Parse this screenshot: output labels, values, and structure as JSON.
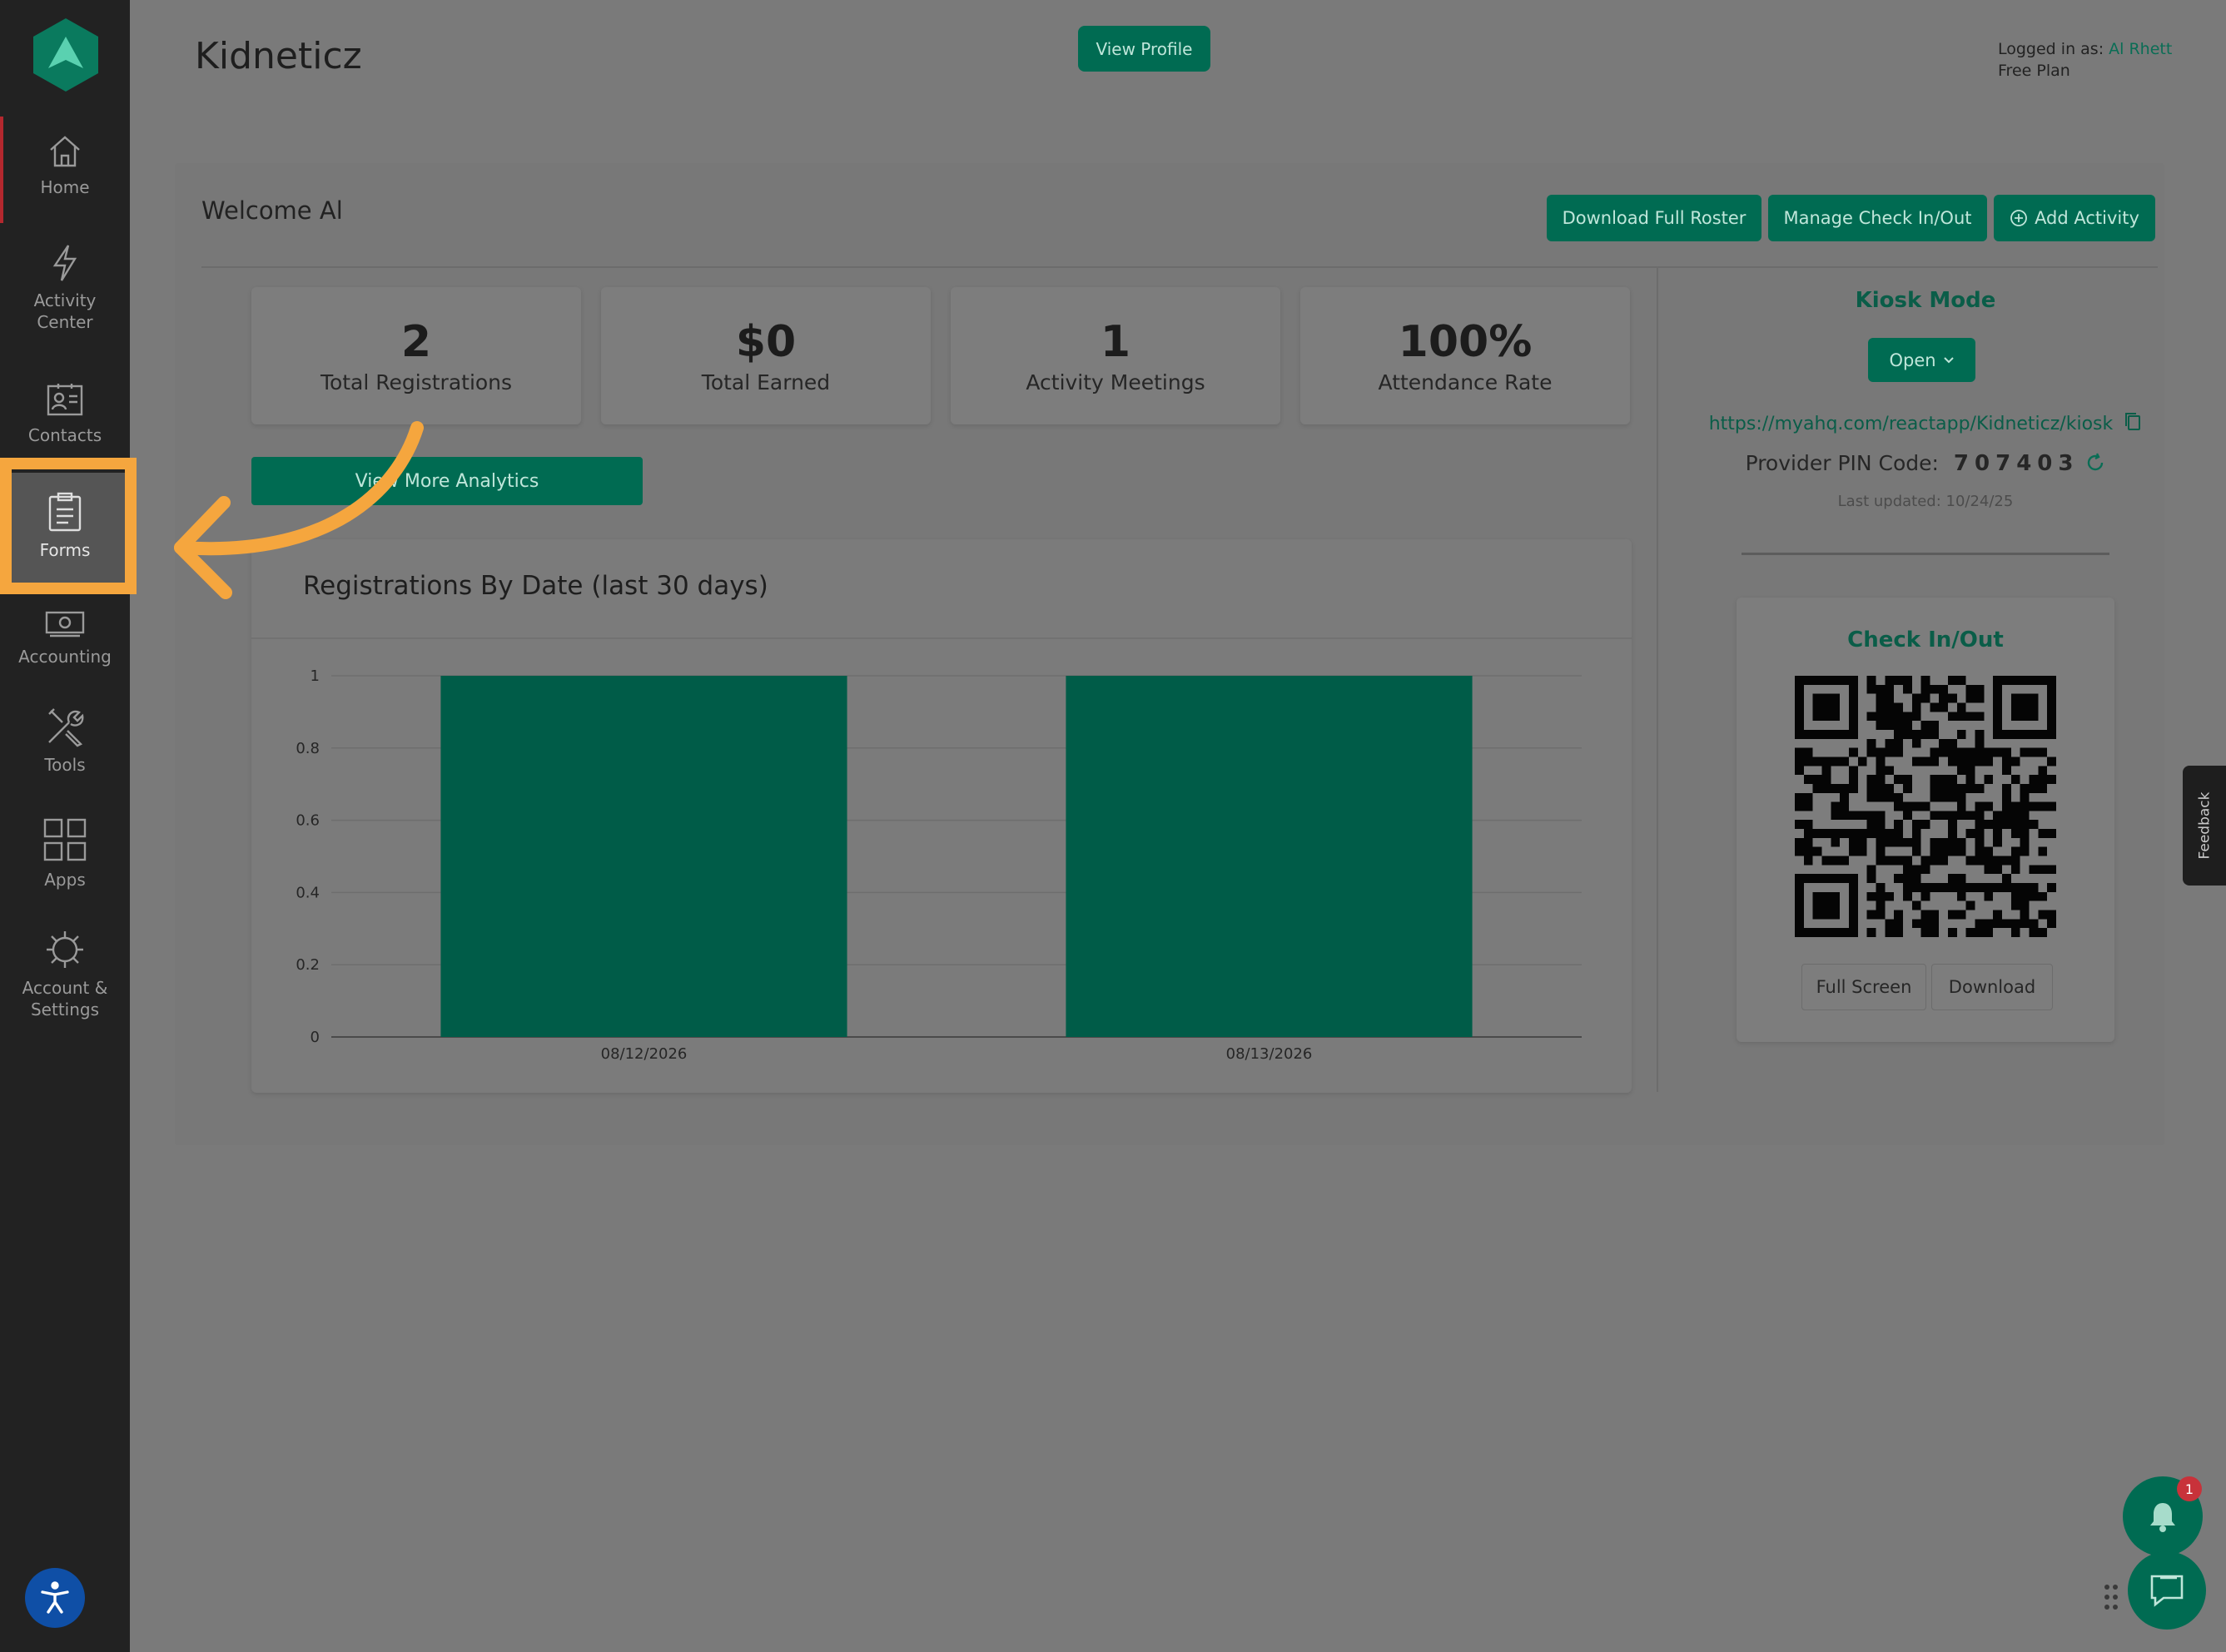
{
  "sidebar": {
    "items": [
      {
        "label": "Home",
        "icon": "home-icon"
      },
      {
        "label": "Activity\nCenter",
        "icon": "lightning-icon"
      },
      {
        "label": "Contacts",
        "icon": "contacts-icon"
      },
      {
        "label": "Forms",
        "icon": "clipboard-icon"
      },
      {
        "label": "Accounting",
        "icon": "money-icon"
      },
      {
        "label": "Tools",
        "icon": "tools-icon"
      },
      {
        "label": "Apps",
        "icon": "grid-icon"
      },
      {
        "label": "Account &\nSettings",
        "icon": "gear-icon"
      }
    ],
    "active": "Forms"
  },
  "header": {
    "title": "Kidneticz",
    "view_profile": "View Profile",
    "logged_in_label": "Logged in as:",
    "user_name": "Al Rhett",
    "plan": "Free Plan"
  },
  "welcome": {
    "text": "Welcome Al",
    "buttons": {
      "download_roster": "Download Full Roster",
      "manage_checkin": "Manage Check In/Out",
      "add_activity": "Add Activity"
    }
  },
  "stats": [
    {
      "value": "2",
      "label": "Total Registrations"
    },
    {
      "value": "$0",
      "label": "Total Earned"
    },
    {
      "value": "1",
      "label": "Activity Meetings"
    },
    {
      "value": "100%",
      "label": "Attendance Rate"
    }
  ],
  "analytics_button": "View More Analytics",
  "chart_data": {
    "type": "bar",
    "title": "Registrations By Date (last 30 days)",
    "categories": [
      "08/12/2026",
      "08/13/2026"
    ],
    "values": [
      1,
      1
    ],
    "yticks": [
      "0",
      "0.2",
      "0.4",
      "0.6",
      "0.8",
      "1"
    ],
    "ylim": [
      0,
      1
    ],
    "grid": true,
    "color": "#005c48"
  },
  "kiosk": {
    "title": "Kiosk Mode",
    "status": "Open",
    "url": "https://myahq.com/reactapp/Kidneticz/kiosk",
    "pin_label": "Provider PIN Code:",
    "pin": "707403",
    "last_updated": "Last updated: 10/24/25"
  },
  "checkin": {
    "title": "Check In/Out",
    "full_screen": "Full Screen",
    "download": "Download"
  },
  "feedback": "Feedback",
  "notifications": {
    "count": "1"
  },
  "colors": {
    "brand": "#006b52",
    "annotation": "#f5a63e"
  }
}
